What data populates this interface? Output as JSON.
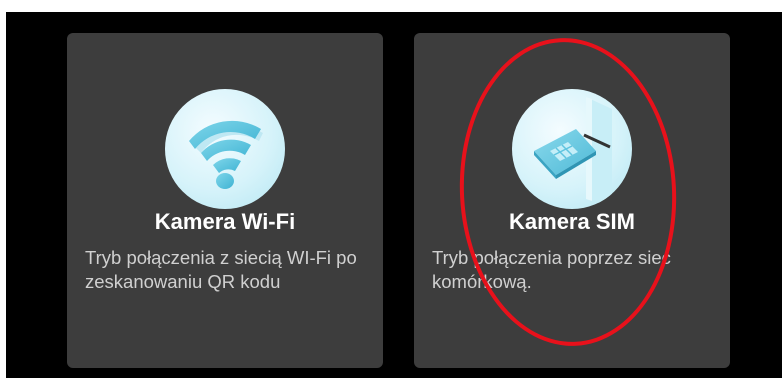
{
  "cards": [
    {
      "title": "Kamera Wi-Fi",
      "description": "Tryb połączenia z siecią WI-Fi po zeskanowaniu QR kodu",
      "icon": "wifi-icon"
    },
    {
      "title": "Kamera SIM",
      "description": "Tryb połączenia poprzez sieć komórkową.",
      "icon": "sim-card-icon"
    }
  ],
  "colors": {
    "background": "#000000",
    "card": "#3d3d3d",
    "title": "#ffffff",
    "description": "#d0d0d0",
    "icon_bg": "#d6f3fa",
    "icon_accent": "#5fc4df",
    "highlight": "#e8111b"
  }
}
